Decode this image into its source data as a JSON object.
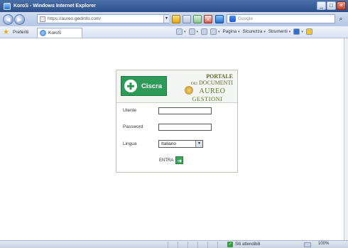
{
  "window": {
    "title": "KoroS - Windows Internet Explorer",
    "minimize": "_",
    "maximize": "□",
    "close": "×"
  },
  "addressbar": {
    "url": "https://aureo.gedinfo.com/",
    "dropdown": "▾",
    "back": "◀",
    "forward": "▶"
  },
  "search": {
    "placeholder": "Google",
    "go": "⌕"
  },
  "favorites": {
    "label": "Preferiti",
    "tab_title": "KoroS"
  },
  "commands": [
    {
      "label": "Pagina"
    },
    {
      "label": "Sicurezza"
    },
    {
      "label": "Strumenti"
    }
  ],
  "login": {
    "brand": "Ciscra",
    "portale_line1": "PORTALE",
    "portale_dei": "DEI",
    "portale_line2": "DOCUMENTI",
    "aureo_line1": "AUREO",
    "aureo_line2": "GESTIONI",
    "user_label": "Utente",
    "password_label": "Password",
    "language_label": "Lingua",
    "language_value": "Italiano",
    "submit_label": "ENTRA"
  },
  "status": {
    "zone": "Siti attendibili",
    "zoom": "100%"
  },
  "colors": {
    "brand_green": "#2e9a58",
    "title_blue": "#2d4f8a"
  }
}
